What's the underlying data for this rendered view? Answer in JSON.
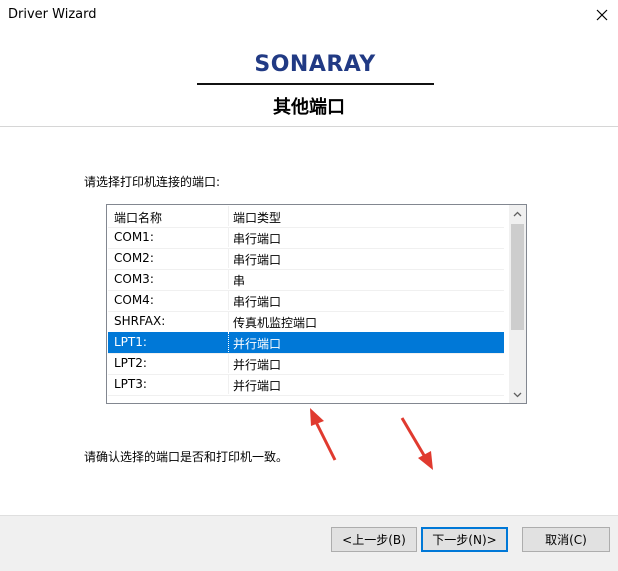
{
  "window": {
    "title": "Driver Wizard",
    "close_icon": "close-icon"
  },
  "logo": {
    "text": "SONARAY",
    "color": "#213a84"
  },
  "page": {
    "heading": "其他端口",
    "prompt": "请选择打印机连接的端口:",
    "confirm": "请确认选择的端口是否和打印机一致。"
  },
  "port_list": {
    "columns": [
      "端口名称",
      "端口类型"
    ],
    "rows": [
      {
        "name": "COM1:",
        "type": "串行端口"
      },
      {
        "name": "COM2:",
        "type": "串行端口"
      },
      {
        "name": "COM3:",
        "type": "串"
      },
      {
        "name": "COM4:",
        "type": "串行端口"
      },
      {
        "name": "SHRFAX:",
        "type": "传真机监控端口"
      },
      {
        "name": "LPT1:",
        "type": "并行端口"
      },
      {
        "name": "LPT2:",
        "type": "并行端口"
      },
      {
        "name": "LPT3:",
        "type": "并行端口"
      }
    ],
    "selected_row": "LPT1:",
    "selection_color": "#0078d7",
    "scroll_position": 0.0
  },
  "buttons": {
    "back": "<上一步(B)",
    "next": "下一步(N)>",
    "cancel": "取消(C)"
  },
  "annotation_color": "#e03a2f"
}
